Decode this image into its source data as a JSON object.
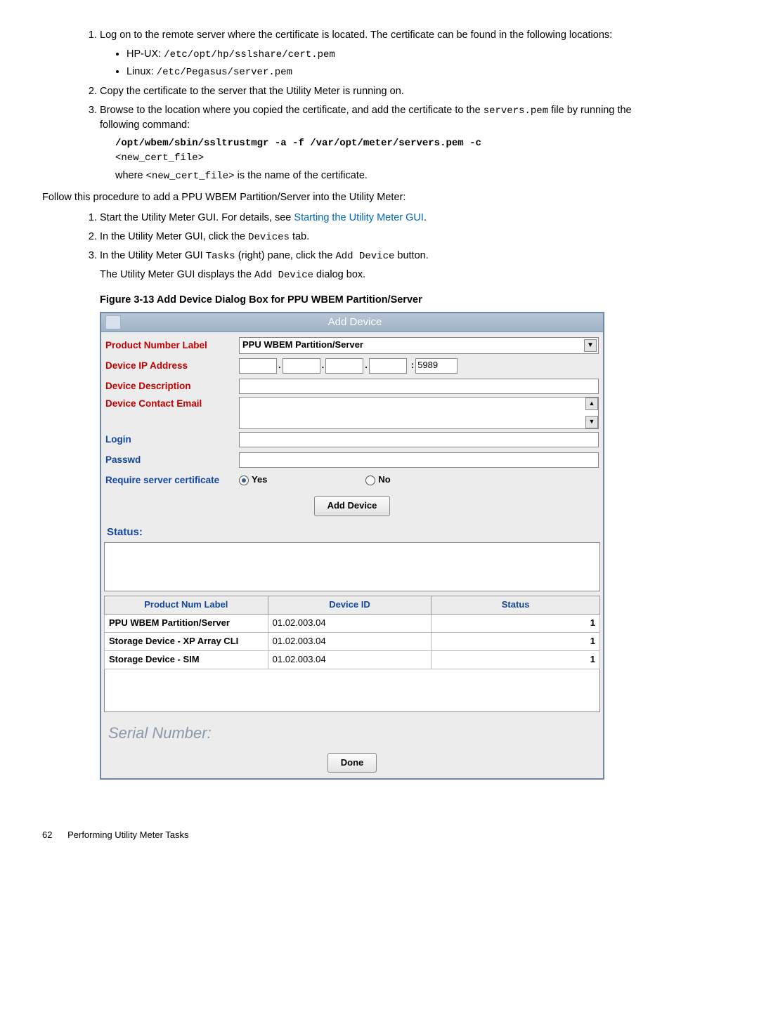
{
  "step1": {
    "text": "Log on to the remote server where the certificate is located. The certificate can be found in the following locations:",
    "bullet1_prefix": "HP-UX: ",
    "bullet1_path": "/etc/opt/hp/sslshare/cert.pem",
    "bullet2_prefix": "Linux: ",
    "bullet2_path": "/etc/Pegasus/server.pem"
  },
  "step2": "Copy the certificate to the server that the Utility Meter is running on.",
  "step3": {
    "line1a": "Browse to the location where you copied the certificate, and add the certificate to the ",
    "line1code": "servers.pem",
    "line1b": " file by running the following command:",
    "cmd": "/opt/wbem/sbin/ssltrustmgr -a -f /var/opt/meter/servers.pem -c",
    "arg": "<new_cert_file>",
    "where_a": "where ",
    "where_code": "<new_cert_file>",
    "where_b": " is the name of the certificate."
  },
  "intro2": "Follow this procedure to add a PPU WBEM Partition/Server into the Utility Meter:",
  "proc": {
    "s1a": "Start the Utility Meter GUI. For details, see ",
    "s1link": "Starting the Utility Meter GUI",
    "s1b": ".",
    "s2a": "In the Utility Meter GUI, click the ",
    "s2code": "Devices",
    "s2b": " tab.",
    "s3a": "In the Utility Meter GUI ",
    "s3code1": "Tasks",
    "s3b": " (right) pane, click the ",
    "s3code2": "Add Device",
    "s3c": " button.",
    "s3line2a": "The Utility Meter GUI displays the ",
    "s3line2code": "Add Device",
    "s3line2b": " dialog box."
  },
  "figcap": "Figure 3-13 Add Device Dialog Box for PPU WBEM Partition/Server",
  "dialog": {
    "title": "Add Device",
    "labels": {
      "product": "Product Number Label",
      "ip": "Device IP Address",
      "desc": "Device Description",
      "email": "Device Contact Email",
      "login": "Login",
      "passwd": "Passwd",
      "reqcert": "Require server certificate"
    },
    "product_value": "PPU WBEM Partition/Server",
    "ip_sep": ".",
    "port_sep": ":",
    "port": "5989",
    "yes": "Yes",
    "no": "No",
    "add_btn": "Add Device",
    "status": "Status:",
    "table": {
      "h1": "Product Num Label",
      "h2": "Device ID",
      "h3": "Status",
      "rows": [
        {
          "c1": "PPU WBEM Partition/Server",
          "c2": "01.02.003.04",
          "c3": "1"
        },
        {
          "c1": "Storage Device - XP Array CLI",
          "c2": "01.02.003.04",
          "c3": "1"
        },
        {
          "c1": "Storage Device - SIM",
          "c2": "01.02.003.04",
          "c3": "1"
        }
      ]
    },
    "serial": "Serial Number:",
    "done": "Done"
  },
  "footer": {
    "page": "62",
    "title": "Performing Utility Meter Tasks"
  }
}
